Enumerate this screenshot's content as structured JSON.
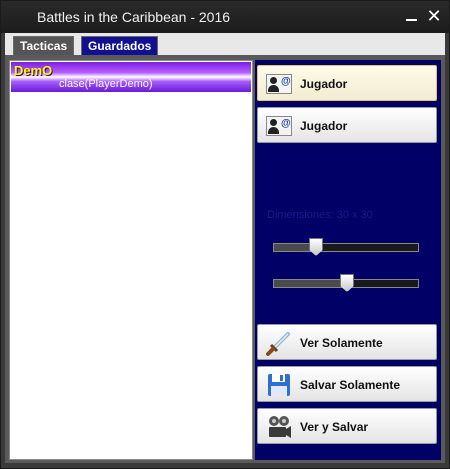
{
  "window": {
    "title": "Battles in the Caribbean - 2016"
  },
  "tabs": [
    {
      "label": "Tacticas",
      "active": true
    },
    {
      "label": "Guardados",
      "active": false
    }
  ],
  "list": {
    "items": [
      {
        "name": "DemO",
        "class_text": "clase(PlayerDemo)"
      }
    ]
  },
  "players": [
    {
      "label": "Jugador",
      "icon": "contact-card-icon"
    },
    {
      "label": "Jugador",
      "icon": "contact-card-icon"
    }
  ],
  "dimensions": {
    "label": "Dimensiones: 30 x 30",
    "slider1_value": 0.27,
    "slider2_value": 0.51
  },
  "actions": [
    {
      "label": "Ver Solamente",
      "icon": "sword-icon"
    },
    {
      "label": "Salvar Solamente",
      "icon": "floppy-disk-icon"
    },
    {
      "label": "Ver y Salvar",
      "icon": "camera-reel-icon"
    }
  ],
  "colors": {
    "accent_panel": "#000066",
    "highlight_item": "#8a2be2",
    "item_name": "#ffff00"
  }
}
